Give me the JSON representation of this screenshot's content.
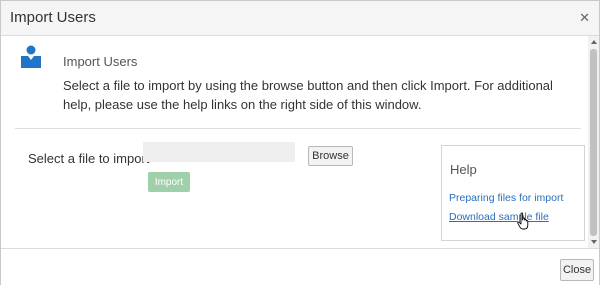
{
  "dialog": {
    "title": "Import Users",
    "close_icon": "close-icon"
  },
  "content": {
    "icon": "user-icon",
    "section_title": "Import Users",
    "description": "Select a file to import by using the browse button and then click Import. For additional help, please use the help links on the right side of this window.",
    "file_label": "Select a file to import",
    "file_value": "",
    "browse_label": "Browse",
    "import_label": "Import"
  },
  "help": {
    "title": "Help",
    "links": [
      {
        "label": "Preparing files for import"
      },
      {
        "label": "Download sample file"
      }
    ]
  },
  "footer": {
    "close_label": "Close"
  },
  "colors": {
    "accent_icon": "#1f76c8",
    "import_button_disabled": "#9fd0aa",
    "link": "#2a6ebb"
  }
}
